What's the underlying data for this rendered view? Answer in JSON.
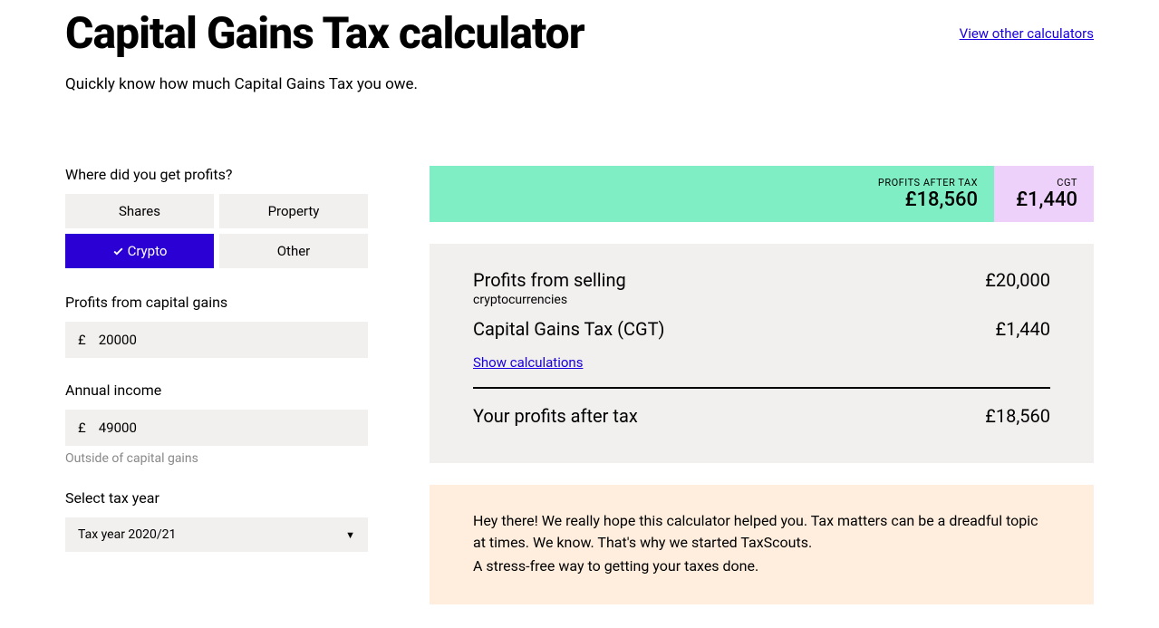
{
  "header": {
    "title": "Capital Gains Tax calculator",
    "view_other": "View other calculators",
    "subtitle": "Quickly know how much Capital Gains Tax you owe."
  },
  "form": {
    "profits_source_label": "Where did you get profits?",
    "options": {
      "shares": "Shares",
      "property": "Property",
      "crypto": "Crypto",
      "other": "Other"
    },
    "selected": "crypto",
    "profits_label": "Profits from capital gains",
    "profits_value": "20000",
    "currency_prefix": "£",
    "income_label": "Annual income",
    "income_value": "49000",
    "income_hint": "Outside of capital gains",
    "tax_year_label": "Select tax year",
    "tax_year_value": "Tax year 2020/21"
  },
  "summary": {
    "profits_after_tax_label": "PROFITS AFTER TAX",
    "profits_after_tax_value": "£18,560",
    "cgt_label": "CGT",
    "cgt_value": "£1,440"
  },
  "details": {
    "row1_label": "Profits from selling",
    "row1_sub": "cryptocurrencies",
    "row1_value": "£20,000",
    "row2_label": "Capital Gains Tax (CGT)",
    "row2_value": "£1,440",
    "show_calc": "Show calculations",
    "row3_label": "Your profits after tax",
    "row3_value": "£18,560"
  },
  "promo": {
    "line1": "Hey there! We really hope this calculator helped you. Tax matters can be a dreadful topic at times. We know. That's why we started TaxScouts.",
    "line2": "A stress-free way to getting your taxes done."
  }
}
